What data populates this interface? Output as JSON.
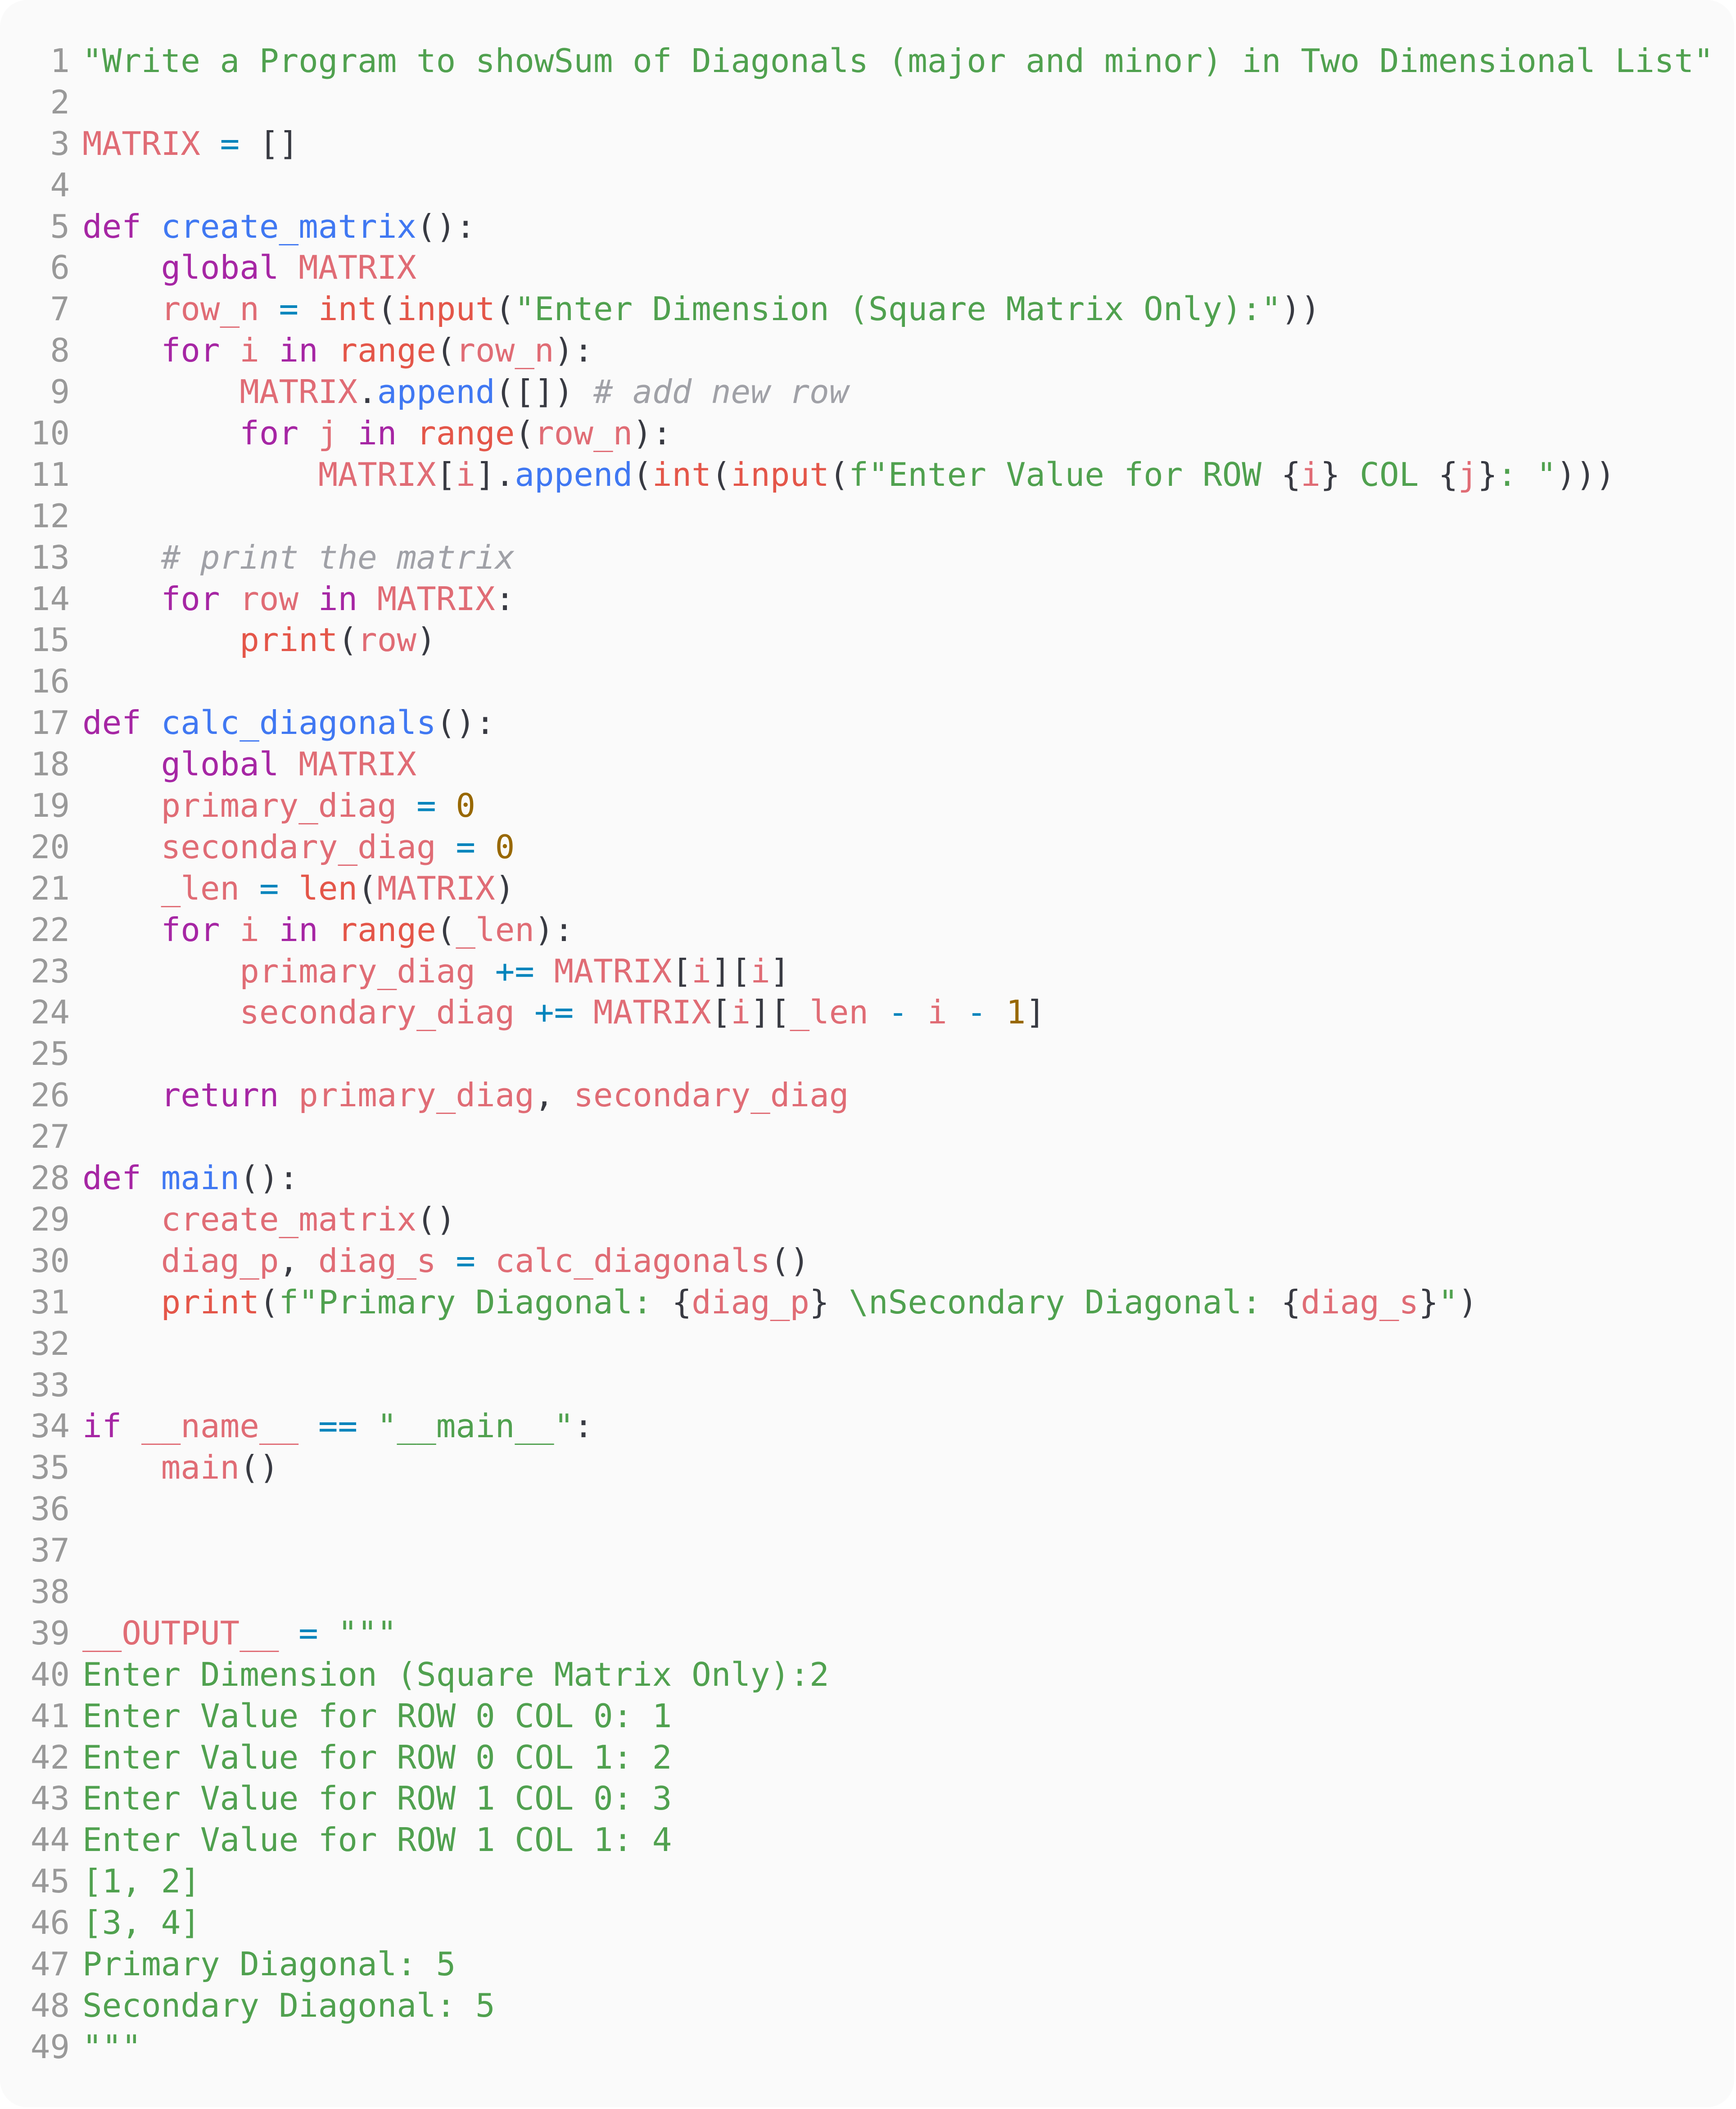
{
  "editor": {
    "language": "python",
    "theme_colors": {
      "background": "#fafafa",
      "line_number": "#999999",
      "keyword": "#a626a4",
      "function": "#4078f2",
      "string": "#50a14f",
      "variable": "#e06c75",
      "builtin": "#e45649",
      "operator": "#0184bc",
      "number": "#986801",
      "comment": "#a0a1a7",
      "punctuation": "#383a42"
    },
    "lines": [
      {
        "n": "1",
        "tokens": [
          [
            "str",
            "\"Write a Program to showSum of Diagonals (major and minor) in Two Dimensional List\""
          ]
        ]
      },
      {
        "n": "2",
        "tokens": []
      },
      {
        "n": "3",
        "tokens": [
          [
            "var",
            "MATRIX"
          ],
          [
            "pn",
            " "
          ],
          [
            "op",
            "="
          ],
          [
            "pn",
            " []"
          ]
        ]
      },
      {
        "n": "4",
        "tokens": []
      },
      {
        "n": "5",
        "tokens": [
          [
            "kw",
            "def"
          ],
          [
            "pn",
            " "
          ],
          [
            "fn",
            "create_matrix"
          ],
          [
            "pn",
            "():"
          ]
        ]
      },
      {
        "n": "6",
        "tokens": [
          [
            "pn",
            "    "
          ],
          [
            "kw",
            "global"
          ],
          [
            "pn",
            " "
          ],
          [
            "var",
            "MATRIX"
          ]
        ]
      },
      {
        "n": "7",
        "tokens": [
          [
            "pn",
            "    "
          ],
          [
            "var",
            "row_n"
          ],
          [
            "pn",
            " "
          ],
          [
            "op",
            "="
          ],
          [
            "pn",
            " "
          ],
          [
            "bi",
            "int"
          ],
          [
            "pn",
            "("
          ],
          [
            "bi",
            "input"
          ],
          [
            "pn",
            "("
          ],
          [
            "str",
            "\"Enter Dimension (Square Matrix Only):\""
          ],
          [
            "pn",
            "))"
          ]
        ]
      },
      {
        "n": "8",
        "tokens": [
          [
            "pn",
            "    "
          ],
          [
            "kw",
            "for"
          ],
          [
            "pn",
            " "
          ],
          [
            "var",
            "i"
          ],
          [
            "pn",
            " "
          ],
          [
            "kw",
            "in"
          ],
          [
            "pn",
            " "
          ],
          [
            "bi",
            "range"
          ],
          [
            "pn",
            "("
          ],
          [
            "var",
            "row_n"
          ],
          [
            "pn",
            "):"
          ]
        ]
      },
      {
        "n": "9",
        "tokens": [
          [
            "pn",
            "        "
          ],
          [
            "var",
            "MATRIX"
          ],
          [
            "pn",
            "."
          ],
          [
            "fn",
            "append"
          ],
          [
            "pn",
            "([]) "
          ],
          [
            "cm",
            "# add new row"
          ]
        ]
      },
      {
        "n": "10",
        "tokens": [
          [
            "pn",
            "        "
          ],
          [
            "kw",
            "for"
          ],
          [
            "pn",
            " "
          ],
          [
            "var",
            "j"
          ],
          [
            "pn",
            " "
          ],
          [
            "kw",
            "in"
          ],
          [
            "pn",
            " "
          ],
          [
            "bi",
            "range"
          ],
          [
            "pn",
            "("
          ],
          [
            "var",
            "row_n"
          ],
          [
            "pn",
            "):"
          ]
        ]
      },
      {
        "n": "11",
        "tokens": [
          [
            "pn",
            "            "
          ],
          [
            "var",
            "MATRIX"
          ],
          [
            "pn",
            "["
          ],
          [
            "var",
            "i"
          ],
          [
            "pn",
            "]."
          ],
          [
            "fn",
            "append"
          ],
          [
            "pn",
            "("
          ],
          [
            "bi",
            "int"
          ],
          [
            "pn",
            "("
          ],
          [
            "bi",
            "input"
          ],
          [
            "pn",
            "("
          ],
          [
            "str",
            "f\"Enter Value for ROW "
          ],
          [
            "pn",
            "{"
          ],
          [
            "var",
            "i"
          ],
          [
            "pn",
            "}"
          ],
          [
            "str",
            " COL "
          ],
          [
            "pn",
            "{"
          ],
          [
            "var",
            "j"
          ],
          [
            "pn",
            "}"
          ],
          [
            "str",
            ": \""
          ],
          [
            "pn",
            ")))"
          ]
        ]
      },
      {
        "n": "12",
        "tokens": []
      },
      {
        "n": "13",
        "tokens": [
          [
            "pn",
            "    "
          ],
          [
            "cm",
            "# print the matrix"
          ]
        ]
      },
      {
        "n": "14",
        "tokens": [
          [
            "pn",
            "    "
          ],
          [
            "kw",
            "for"
          ],
          [
            "pn",
            " "
          ],
          [
            "var",
            "row"
          ],
          [
            "pn",
            " "
          ],
          [
            "kw",
            "in"
          ],
          [
            "pn",
            " "
          ],
          [
            "var",
            "MATRIX"
          ],
          [
            "pn",
            ":"
          ]
        ]
      },
      {
        "n": "15",
        "tokens": [
          [
            "pn",
            "        "
          ],
          [
            "bi",
            "print"
          ],
          [
            "pn",
            "("
          ],
          [
            "var",
            "row"
          ],
          [
            "pn",
            ")"
          ]
        ]
      },
      {
        "n": "16",
        "tokens": []
      },
      {
        "n": "17",
        "tokens": [
          [
            "kw",
            "def"
          ],
          [
            "pn",
            " "
          ],
          [
            "fn",
            "calc_diagonals"
          ],
          [
            "pn",
            "():"
          ]
        ]
      },
      {
        "n": "18",
        "tokens": [
          [
            "pn",
            "    "
          ],
          [
            "kw",
            "global"
          ],
          [
            "pn",
            " "
          ],
          [
            "var",
            "MATRIX"
          ]
        ]
      },
      {
        "n": "19",
        "tokens": [
          [
            "pn",
            "    "
          ],
          [
            "var",
            "primary_diag"
          ],
          [
            "pn",
            " "
          ],
          [
            "op",
            "="
          ],
          [
            "pn",
            " "
          ],
          [
            "num",
            "0"
          ]
        ]
      },
      {
        "n": "20",
        "tokens": [
          [
            "pn",
            "    "
          ],
          [
            "var",
            "secondary_diag"
          ],
          [
            "pn",
            " "
          ],
          [
            "op",
            "="
          ],
          [
            "pn",
            " "
          ],
          [
            "num",
            "0"
          ]
        ]
      },
      {
        "n": "21",
        "tokens": [
          [
            "pn",
            "    "
          ],
          [
            "var",
            "_len"
          ],
          [
            "pn",
            " "
          ],
          [
            "op",
            "="
          ],
          [
            "pn",
            " "
          ],
          [
            "bi",
            "len"
          ],
          [
            "pn",
            "("
          ],
          [
            "var",
            "MATRIX"
          ],
          [
            "pn",
            ")"
          ]
        ]
      },
      {
        "n": "22",
        "tokens": [
          [
            "pn",
            "    "
          ],
          [
            "kw",
            "for"
          ],
          [
            "pn",
            " "
          ],
          [
            "var",
            "i"
          ],
          [
            "pn",
            " "
          ],
          [
            "kw",
            "in"
          ],
          [
            "pn",
            " "
          ],
          [
            "bi",
            "range"
          ],
          [
            "pn",
            "("
          ],
          [
            "var",
            "_len"
          ],
          [
            "pn",
            "):"
          ]
        ]
      },
      {
        "n": "23",
        "tokens": [
          [
            "pn",
            "        "
          ],
          [
            "var",
            "primary_diag"
          ],
          [
            "pn",
            " "
          ],
          [
            "op",
            "+="
          ],
          [
            "pn",
            " "
          ],
          [
            "var",
            "MATRIX"
          ],
          [
            "pn",
            "["
          ],
          [
            "var",
            "i"
          ],
          [
            "pn",
            "]["
          ],
          [
            "var",
            "i"
          ],
          [
            "pn",
            "]"
          ]
        ]
      },
      {
        "n": "24",
        "tokens": [
          [
            "pn",
            "        "
          ],
          [
            "var",
            "secondary_diag"
          ],
          [
            "pn",
            " "
          ],
          [
            "op",
            "+="
          ],
          [
            "pn",
            " "
          ],
          [
            "var",
            "MATRIX"
          ],
          [
            "pn",
            "["
          ],
          [
            "var",
            "i"
          ],
          [
            "pn",
            "]["
          ],
          [
            "var",
            "_len"
          ],
          [
            "pn",
            " "
          ],
          [
            "op",
            "-"
          ],
          [
            "pn",
            " "
          ],
          [
            "var",
            "i"
          ],
          [
            "pn",
            " "
          ],
          [
            "op",
            "-"
          ],
          [
            "pn",
            " "
          ],
          [
            "num",
            "1"
          ],
          [
            "pn",
            "]"
          ]
        ]
      },
      {
        "n": "25",
        "tokens": []
      },
      {
        "n": "26",
        "tokens": [
          [
            "pn",
            "    "
          ],
          [
            "kw",
            "return"
          ],
          [
            "pn",
            " "
          ],
          [
            "var",
            "primary_diag"
          ],
          [
            "pn",
            ", "
          ],
          [
            "var",
            "secondary_diag"
          ]
        ]
      },
      {
        "n": "27",
        "tokens": []
      },
      {
        "n": "28",
        "tokens": [
          [
            "kw",
            "def"
          ],
          [
            "pn",
            " "
          ],
          [
            "fn",
            "main"
          ],
          [
            "pn",
            "():"
          ]
        ]
      },
      {
        "n": "29",
        "tokens": [
          [
            "pn",
            "    "
          ],
          [
            "var",
            "create_matrix"
          ],
          [
            "pn",
            "()"
          ]
        ]
      },
      {
        "n": "30",
        "tokens": [
          [
            "pn",
            "    "
          ],
          [
            "var",
            "diag_p"
          ],
          [
            "pn",
            ", "
          ],
          [
            "var",
            "diag_s"
          ],
          [
            "pn",
            " "
          ],
          [
            "op",
            "="
          ],
          [
            "pn",
            " "
          ],
          [
            "var",
            "calc_diagonals"
          ],
          [
            "pn",
            "()"
          ]
        ]
      },
      {
        "n": "31",
        "tokens": [
          [
            "pn",
            "    "
          ],
          [
            "bi",
            "print"
          ],
          [
            "pn",
            "("
          ],
          [
            "str",
            "f\"Primary Diagonal: "
          ],
          [
            "pn",
            "{"
          ],
          [
            "var",
            "diag_p"
          ],
          [
            "pn",
            "}"
          ],
          [
            "str",
            " \\nSecondary Diagonal: "
          ],
          [
            "pn",
            "{"
          ],
          [
            "var",
            "diag_s"
          ],
          [
            "pn",
            "}"
          ],
          [
            "str",
            "\""
          ],
          [
            "pn",
            ")"
          ]
        ]
      },
      {
        "n": "32",
        "tokens": []
      },
      {
        "n": "33",
        "tokens": []
      },
      {
        "n": "34",
        "tokens": [
          [
            "kw",
            "if"
          ],
          [
            "pn",
            " "
          ],
          [
            "var",
            "__name__"
          ],
          [
            "pn",
            " "
          ],
          [
            "op",
            "=="
          ],
          [
            "pn",
            " "
          ],
          [
            "str",
            "\"__main__\""
          ],
          [
            "pn",
            ":"
          ]
        ]
      },
      {
        "n": "35",
        "tokens": [
          [
            "pn",
            "    "
          ],
          [
            "var",
            "main"
          ],
          [
            "pn",
            "()"
          ]
        ]
      },
      {
        "n": "36",
        "tokens": []
      },
      {
        "n": "37",
        "tokens": []
      },
      {
        "n": "38",
        "tokens": []
      },
      {
        "n": "39",
        "tokens": [
          [
            "var",
            "__OUTPUT__"
          ],
          [
            "pn",
            " "
          ],
          [
            "op",
            "="
          ],
          [
            "pn",
            " "
          ],
          [
            "str",
            "\"\"\""
          ]
        ]
      },
      {
        "n": "40",
        "tokens": [
          [
            "str",
            "Enter Dimension (Square Matrix Only):2"
          ]
        ]
      },
      {
        "n": "41",
        "tokens": [
          [
            "str",
            "Enter Value for ROW 0 COL 0: 1"
          ]
        ]
      },
      {
        "n": "42",
        "tokens": [
          [
            "str",
            "Enter Value for ROW 0 COL 1: 2"
          ]
        ]
      },
      {
        "n": "43",
        "tokens": [
          [
            "str",
            "Enter Value for ROW 1 COL 0: 3"
          ]
        ]
      },
      {
        "n": "44",
        "tokens": [
          [
            "str",
            "Enter Value for ROW 1 COL 1: 4"
          ]
        ]
      },
      {
        "n": "45",
        "tokens": [
          [
            "str",
            "[1, 2]"
          ]
        ]
      },
      {
        "n": "46",
        "tokens": [
          [
            "str",
            "[3, 4]"
          ]
        ]
      },
      {
        "n": "47",
        "tokens": [
          [
            "str",
            "Primary Diagonal: 5"
          ]
        ]
      },
      {
        "n": "48",
        "tokens": [
          [
            "str",
            "Secondary Diagonal: 5"
          ]
        ]
      },
      {
        "n": "49",
        "tokens": [
          [
            "str",
            "\"\"\""
          ]
        ]
      }
    ]
  }
}
